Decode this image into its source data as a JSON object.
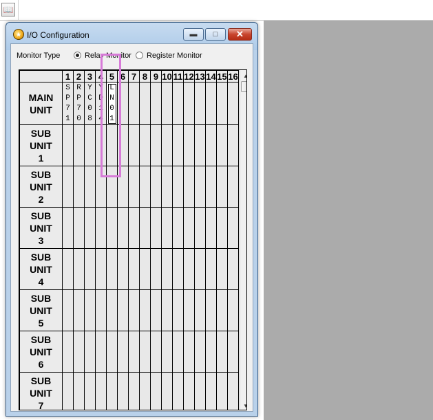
{
  "window": {
    "title": "I/O Configuration"
  },
  "toolbar": {
    "icon": "book-icon"
  },
  "monitor": {
    "label": "Monitor Type",
    "options": [
      {
        "label": "Relay Monitor",
        "checked": true
      },
      {
        "label": "Register Monitor",
        "checked": false
      }
    ]
  },
  "grid": {
    "columns": [
      "1",
      "2",
      "3",
      "4",
      "5",
      "6",
      "7",
      "8",
      "9",
      "10",
      "11",
      "12",
      "13",
      "14",
      "15",
      "16"
    ],
    "rows": [
      {
        "label": "MAIN\nUNIT",
        "cells": [
          "SP71",
          "RP70",
          "YC08",
          "YD14",
          "LN01",
          "",
          "",
          "",
          "",
          "",
          "",
          "",
          "",
          "",
          "",
          ""
        ]
      },
      {
        "label": "SUB\nUNIT\n1",
        "cells": [
          "",
          "",
          "",
          "",
          "",
          "",
          "",
          "",
          "",
          "",
          "",
          "",
          "",
          "",
          "",
          ""
        ]
      },
      {
        "label": "SUB\nUNIT\n2",
        "cells": [
          "",
          "",
          "",
          "",
          "",
          "",
          "",
          "",
          "",
          "",
          "",
          "",
          "",
          "",
          "",
          ""
        ]
      },
      {
        "label": "SUB\nUNIT\n3",
        "cells": [
          "",
          "",
          "",
          "",
          "",
          "",
          "",
          "",
          "",
          "",
          "",
          "",
          "",
          "",
          "",
          ""
        ]
      },
      {
        "label": "SUB\nUNIT\n4",
        "cells": [
          "",
          "",
          "",
          "",
          "",
          "",
          "",
          "",
          "",
          "",
          "",
          "",
          "",
          "",
          "",
          ""
        ]
      },
      {
        "label": "SUB\nUNIT\n5",
        "cells": [
          "",
          "",
          "",
          "",
          "",
          "",
          "",
          "",
          "",
          "",
          "",
          "",
          "",
          "",
          "",
          ""
        ]
      },
      {
        "label": "SUB\nUNIT\n6",
        "cells": [
          "",
          "",
          "",
          "",
          "",
          "",
          "",
          "",
          "",
          "",
          "",
          "",
          "",
          "",
          "",
          ""
        ]
      },
      {
        "label": "SUB\nUNIT\n7",
        "cells": [
          "",
          "",
          "",
          "",
          "",
          "",
          "",
          "",
          "",
          "",
          "",
          "",
          "",
          "",
          "",
          ""
        ]
      }
    ],
    "selected_cell": {
      "row": 0,
      "col": 4
    }
  },
  "colors": {
    "highlight": "#d77bd8",
    "titlebar": "#b9d1ea",
    "close": "#c8442d"
  }
}
